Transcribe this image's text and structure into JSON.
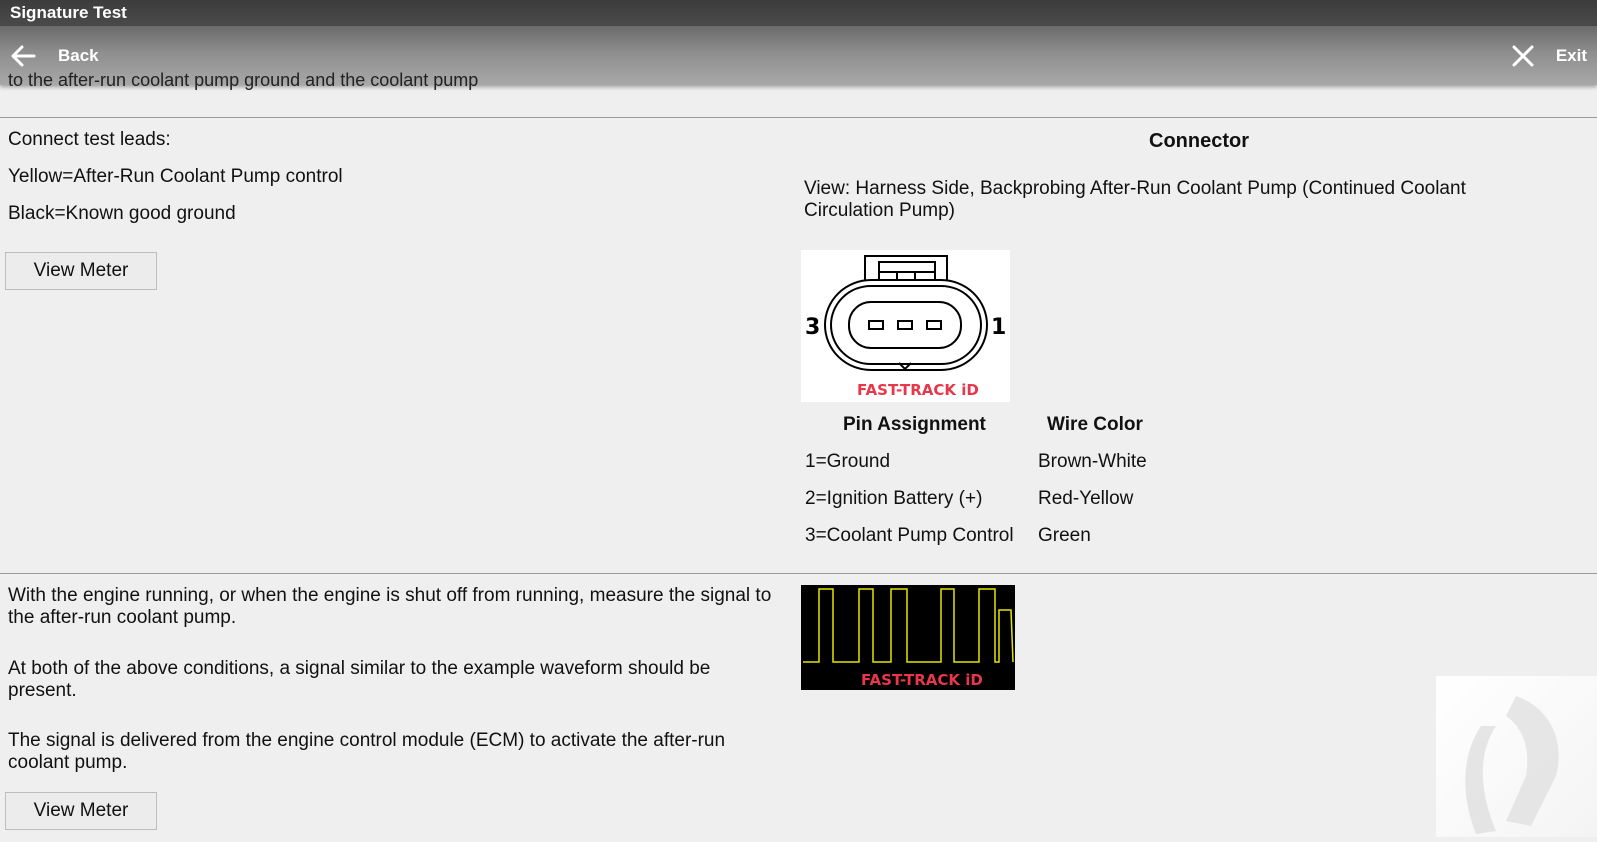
{
  "window": {
    "title": "Signature Test"
  },
  "toolbar": {
    "back_label": "Back",
    "exit_label": "Exit"
  },
  "top_clipped": "to the after-run coolant pump ground and the coolant pump",
  "left": {
    "leads_heading": "Connect test leads:",
    "lead_yellow": "Yellow=After-Run Coolant Pump control",
    "lead_black": "Black=Known good ground",
    "view_meter_1": "View Meter",
    "para1": "With the engine running, or when the engine is shut off from running, measure the signal to the after-run coolant pump.",
    "para2": "At both of the above conditions, a signal similar to the example waveform should be present.",
    "para3": "The signal is delivered from the engine control module (ECM) to activate the after-run coolant pump.",
    "view_meter_2": "View Meter"
  },
  "connector": {
    "heading": "Connector",
    "view_text": "View: Harness Side, Backprobing After-Run Coolant Pump (Continued Coolant Circulation Pump)",
    "pin_left_label": "3",
    "pin_right_label": "1",
    "logo_text": "FAST-TRACK iD",
    "pin_header": "Pin Assignment",
    "wire_header": "Wire Color",
    "pins": [
      {
        "pin": "1=Ground",
        "color": "Brown-White"
      },
      {
        "pin": "2=Ignition Battery (+)",
        "color": "Red-Yellow"
      },
      {
        "pin": "3=Coolant Pump Control",
        "color": "Green"
      }
    ]
  },
  "waveform": {
    "logo_text": "FAST-TRACK iD",
    "trace_color": "#e6e600"
  },
  "colors": {
    "logo_red": "#e8364a",
    "background": "#efefef"
  }
}
